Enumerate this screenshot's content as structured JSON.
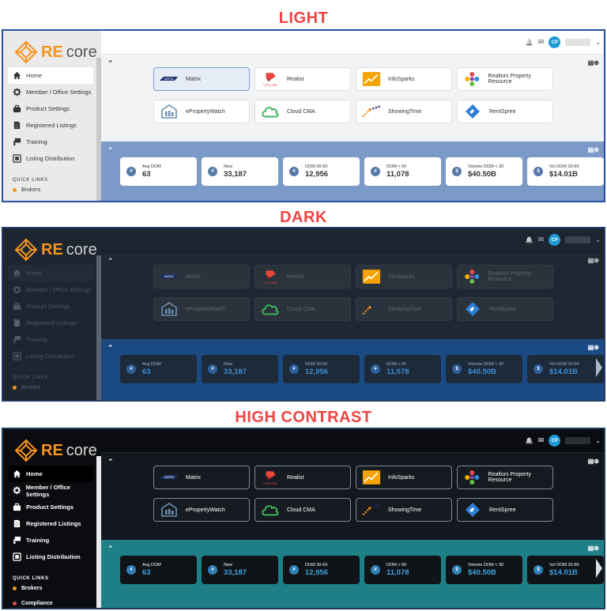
{
  "titles": {
    "light": "LIGHT",
    "dark": "DARK",
    "high_contrast": "HIGH CONTRAST"
  },
  "brand": {
    "prefix": "RE",
    "suffix": "core",
    "color": "#f7941d"
  },
  "nav_items": [
    {
      "label": "Home",
      "icon": "home-icon"
    },
    {
      "label": "Member / Office Settings",
      "icon": "gear-icon"
    },
    {
      "label": "Product Settings",
      "icon": "briefcase-icon"
    },
    {
      "label": "Registered Listings",
      "icon": "document-icon"
    },
    {
      "label": "Training",
      "icon": "training-icon"
    },
    {
      "label": "Listing Distribution",
      "icon": "distribution-icon"
    }
  ],
  "quick_links": {
    "heading": "QUICK LINKS",
    "items": [
      {
        "label": "Brokers",
        "color": "#f7941d"
      },
      {
        "label": "Compliance",
        "color": "#e94b4b"
      }
    ]
  },
  "user": {
    "initials": "CP"
  },
  "apps": [
    {
      "label": "Matrix",
      "icon": "matrix-logo-icon"
    },
    {
      "label": "Realist",
      "icon": "realist-logo-icon"
    },
    {
      "label": "InfoSparks",
      "icon": "chart-icon"
    },
    {
      "label": "Realtors Property Resource",
      "icon": "rpr-logo-icon"
    },
    {
      "label": "ePropertyWatch",
      "icon": "building-icon"
    },
    {
      "label": "Cloud CMA",
      "icon": "cloud-icon"
    },
    {
      "label": "ShowingTime",
      "icon": "showingtime-logo-icon"
    },
    {
      "label": "RentSpree",
      "icon": "rentspree-logo-icon"
    }
  ],
  "stats": [
    {
      "label": "Avg DOM",
      "value": "63",
      "icon": "#"
    },
    {
      "label": "New",
      "value": "33,187",
      "icon": "#"
    },
    {
      "label": "DOM 30-60",
      "value": "12,956",
      "icon": "#"
    },
    {
      "label": "DOM > 60",
      "value": "11,078",
      "icon": "#"
    },
    {
      "label": "Volume DOM < 30",
      "value": "$40.50B",
      "icon": "$"
    },
    {
      "label": "Vol DOM 30-60",
      "value": "$14.01B",
      "icon": "$"
    }
  ]
}
